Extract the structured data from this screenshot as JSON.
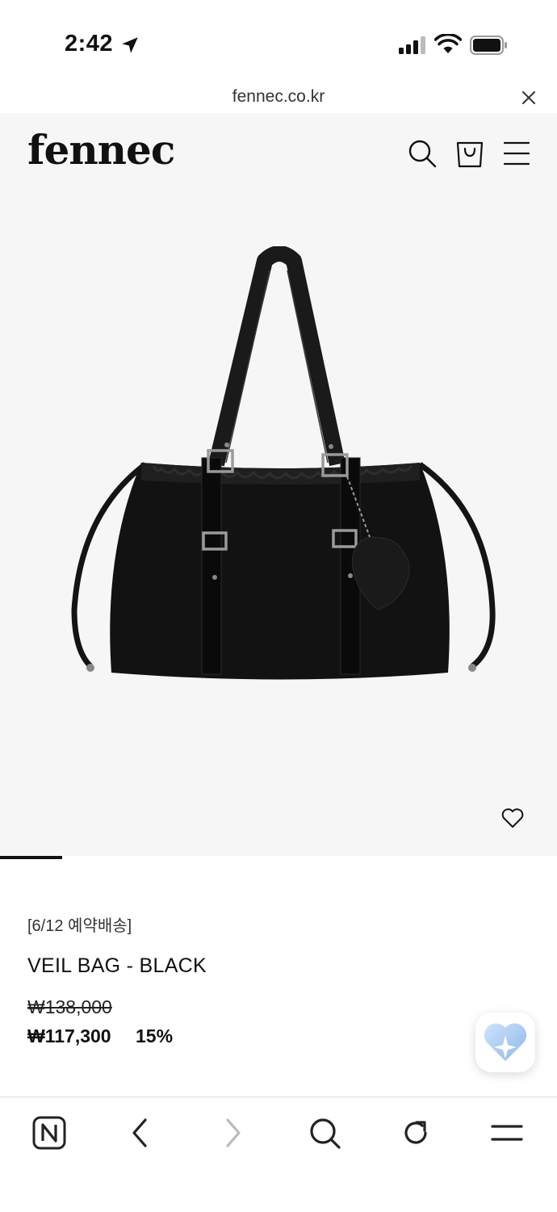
{
  "status_bar": {
    "time": "2:42"
  },
  "browser": {
    "url": "fennec.co.kr"
  },
  "site": {
    "logo": "fennec"
  },
  "product": {
    "tag": "[6/12 예약배송]",
    "name": "VEIL BAG - BLACK",
    "original_price": "₩138,000",
    "sale_price": "₩117,300",
    "discount": "15%"
  },
  "icons": {
    "header": [
      "search-icon",
      "shopping-bag-icon",
      "menu-icon"
    ],
    "bottom_nav": [
      "naver-home-icon",
      "back-icon",
      "forward-icon",
      "search-icon",
      "refresh-icon",
      "menu-icon"
    ]
  },
  "colors": {
    "accent": "#111111",
    "image_bg": "#f6f6f6"
  }
}
